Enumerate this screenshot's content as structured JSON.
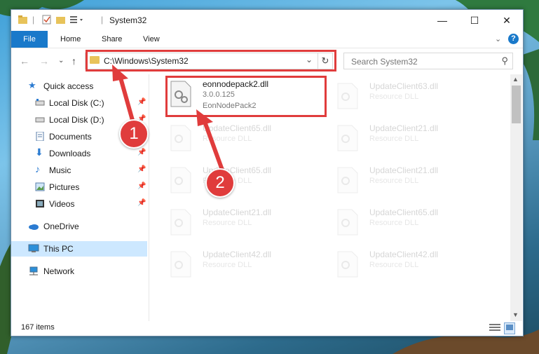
{
  "window": {
    "title": "System32",
    "controls": [
      "minimize",
      "maximize",
      "close"
    ]
  },
  "ribbon": {
    "tabs": [
      "File",
      "Home",
      "Share",
      "View"
    ],
    "help": "?"
  },
  "navigation": {
    "address": "C:\\Windows\\System32",
    "search_placeholder": "Search System32"
  },
  "sidebar": {
    "items": [
      {
        "label": "Quick access",
        "icon": "star-icon"
      },
      {
        "label": "Local Disk (C:)",
        "icon": "drive-icon",
        "pinned": true
      },
      {
        "label": "Local Disk (D:)",
        "icon": "drive-icon",
        "pinned": true
      },
      {
        "label": "Documents",
        "icon": "documents-icon",
        "pinned": true
      },
      {
        "label": "Downloads",
        "icon": "download-icon",
        "pinned": true
      },
      {
        "label": "Music",
        "icon": "music-icon",
        "pinned": true
      },
      {
        "label": "Pictures",
        "icon": "pictures-icon",
        "pinned": true
      },
      {
        "label": "Videos",
        "icon": "videos-icon",
        "pinned": true
      },
      {
        "label": "OneDrive",
        "icon": "cloud-icon"
      },
      {
        "label": "This PC",
        "icon": "computer-icon",
        "selected": true
      },
      {
        "label": "Network",
        "icon": "network-icon"
      }
    ]
  },
  "files": [
    {
      "name": "eonnodepack2.dll",
      "line2": "3.0.0.125",
      "line3": "EonNodePack2",
      "highlighted": true
    },
    {
      "name": "UpdateClient63.dll",
      "line2": "Resource DLL"
    },
    {
      "name": "UpdateClient65.dll",
      "line2": "Resource DLL"
    },
    {
      "name": "UpdateClient21.dll",
      "line2": "Resource DLL"
    },
    {
      "name": "UpdateClient65.dll",
      "line2": "Resource DLL"
    },
    {
      "name": "UpdateClient21.dll",
      "line2": "Resource DLL"
    },
    {
      "name": "UpdateClient21.dll",
      "line2": "Resource DLL"
    },
    {
      "name": "UpdateClient65.dll",
      "line2": "Resource DLL"
    },
    {
      "name": "UpdateClient42.dll",
      "line2": "Resource DLL"
    },
    {
      "name": "UpdateClient42.dll",
      "line2": "Resource DLL"
    }
  ],
  "status": {
    "item_count": "167 items"
  },
  "callouts": [
    "1",
    "2"
  ],
  "colors": {
    "accent": "#1979ca",
    "callout": "#e03c3c",
    "selection": "#cde8ff"
  }
}
